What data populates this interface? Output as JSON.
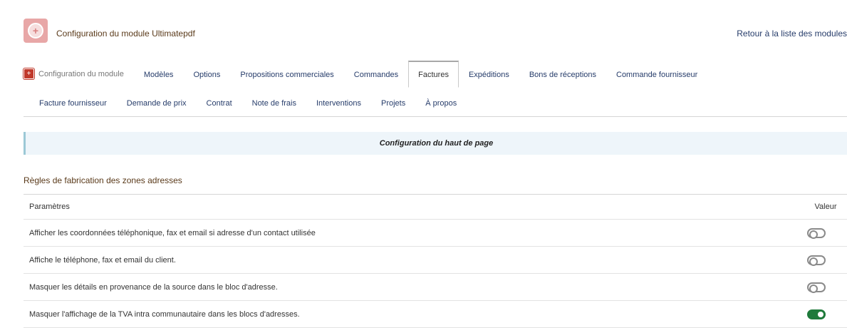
{
  "header": {
    "title": "Configuration du module Ultimatepdf",
    "back_link": "Retour à la liste des modules"
  },
  "tabs_row1": [
    {
      "label": "Configuration du module",
      "icon": "module-config-icon"
    },
    {
      "label": "Modèles"
    },
    {
      "label": "Options"
    },
    {
      "label": "Propositions commerciales"
    },
    {
      "label": "Commandes"
    },
    {
      "label": "Factures",
      "active": true
    },
    {
      "label": "Expéditions"
    },
    {
      "label": "Bons de réceptions"
    },
    {
      "label": "Commande fournisseur"
    }
  ],
  "tabs_row2": [
    {
      "label": "Facture fournisseur"
    },
    {
      "label": "Demande de prix"
    },
    {
      "label": "Contrat"
    },
    {
      "label": "Note de frais"
    },
    {
      "label": "Interventions"
    },
    {
      "label": "Projets"
    },
    {
      "label": "À propos"
    }
  ],
  "banner": {
    "text": "Configuration du haut de page"
  },
  "section": {
    "title": "Règles de fabrication des zones adresses"
  },
  "table": {
    "header_param": "Paramètres",
    "header_value": "Valeur",
    "rows": [
      {
        "label": "Afficher les coordonnées téléphonique, fax et email si adresse d'un contact utilisée",
        "enabled": false
      },
      {
        "label": "Affiche le téléphone, fax et email du client.",
        "enabled": false
      },
      {
        "label": "Masquer les détails en provenance de la source dans le bloc d'adresse.",
        "enabled": false
      },
      {
        "label": "Masquer l'affichage de la TVA intra communautaire dans les blocs d'adresses.",
        "enabled": true
      }
    ]
  },
  "colors": {
    "link": "#263c6a",
    "toggle_on": "#1f7a3b",
    "toggle_off": "#8a8a8a",
    "banner_bg": "#eef5fa",
    "banner_accent": "#9cc9d6"
  }
}
